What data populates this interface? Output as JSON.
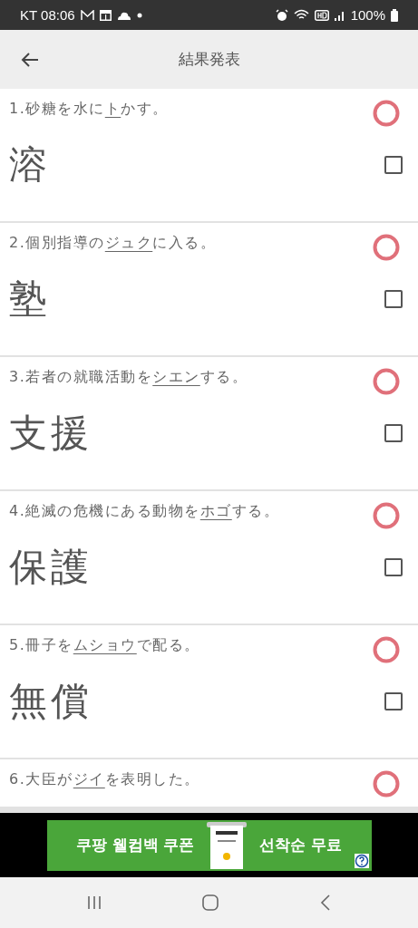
{
  "status_bar": {
    "carrier_time": "KT 08:06",
    "battery": "100%"
  },
  "header": {
    "title": "結果発表"
  },
  "questions": [
    {
      "number": "1.",
      "before": "砂糖を水に",
      "target": "ト",
      "after": "かす。",
      "answer": "溶",
      "correct": true,
      "checked": false
    },
    {
      "number": "2.",
      "before": "個別指導の",
      "target": "ジュク",
      "after": "に入る。",
      "answer": "塾",
      "correct": true,
      "checked": false
    },
    {
      "number": "3.",
      "before": "若者の就職活動を",
      "target": "シエン",
      "after": "する。",
      "answer": "支援",
      "correct": true,
      "checked": false
    },
    {
      "number": "4.",
      "before": "絶滅の危機にある動物を",
      "target": "ホゴ",
      "after": "する。",
      "answer": "保護",
      "correct": true,
      "checked": false
    },
    {
      "number": "5.",
      "before": "冊子を",
      "target": "ムショウ",
      "after": "で配る。",
      "answer": "無償",
      "correct": true,
      "checked": false
    },
    {
      "number": "6.",
      "before": "大臣が",
      "target": "ジイ",
      "after": "を表明した。",
      "correct": true
    }
  ],
  "ad": {
    "left_text": "쿠팡 웰컴백 쿠폰",
    "right_text": "선착순 무료"
  }
}
